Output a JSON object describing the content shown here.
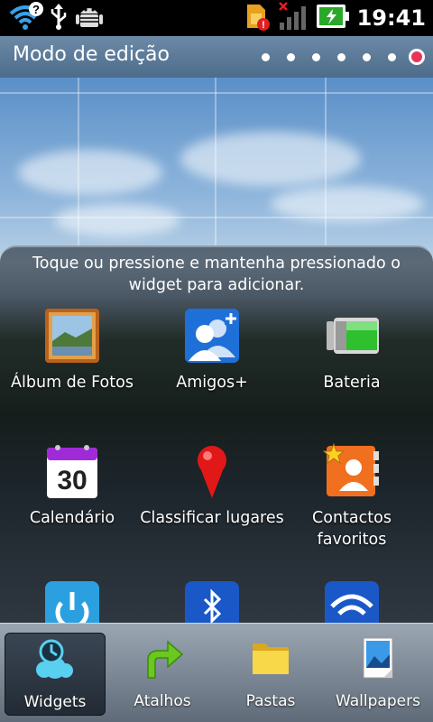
{
  "status_bar": {
    "time": "19:41",
    "icons": [
      "wifi-question-icon",
      "usb-icon",
      "android-debug-icon",
      "sim-alert-icon",
      "no-signal-icon",
      "battery-charging-icon"
    ]
  },
  "edit_bar": {
    "title": "Modo de edição",
    "page_count": 7,
    "active_page": 7
  },
  "panel": {
    "hint": "Toque ou pressione e mantenha pressionado o widget para adicionar.",
    "widgets": [
      {
        "label": "Álbum de Fotos",
        "icon": "photo-album-icon"
      },
      {
        "label": "Amigos+",
        "icon": "friends-icon"
      },
      {
        "label": "Bateria",
        "icon": "battery-widget-icon"
      },
      {
        "label": "Calendário",
        "icon": "calendar-icon",
        "day": "30"
      },
      {
        "label": "Classificar lugares",
        "icon": "map-pin-icon"
      },
      {
        "label": "Contactos favoritos",
        "icon": "favorite-contacts-icon"
      },
      {
        "label": "",
        "icon": "power-control-icon"
      },
      {
        "label": "",
        "icon": "bluetooth-icon"
      },
      {
        "label": "",
        "icon": "wifi-toggle-icon"
      }
    ]
  },
  "tabs": [
    {
      "label": "Widgets",
      "icon": "widgets-icon",
      "active": true
    },
    {
      "label": "Atalhos",
      "icon": "shortcut-arrow-icon",
      "active": false
    },
    {
      "label": "Pastas",
      "icon": "folder-icon",
      "active": false
    },
    {
      "label": "Wallpapers",
      "icon": "wallpaper-icon",
      "active": false
    }
  ],
  "colors": {
    "edit_bar": "#5a7896",
    "active_dot": "#e8335a",
    "tab_bar": "#7d8894"
  }
}
